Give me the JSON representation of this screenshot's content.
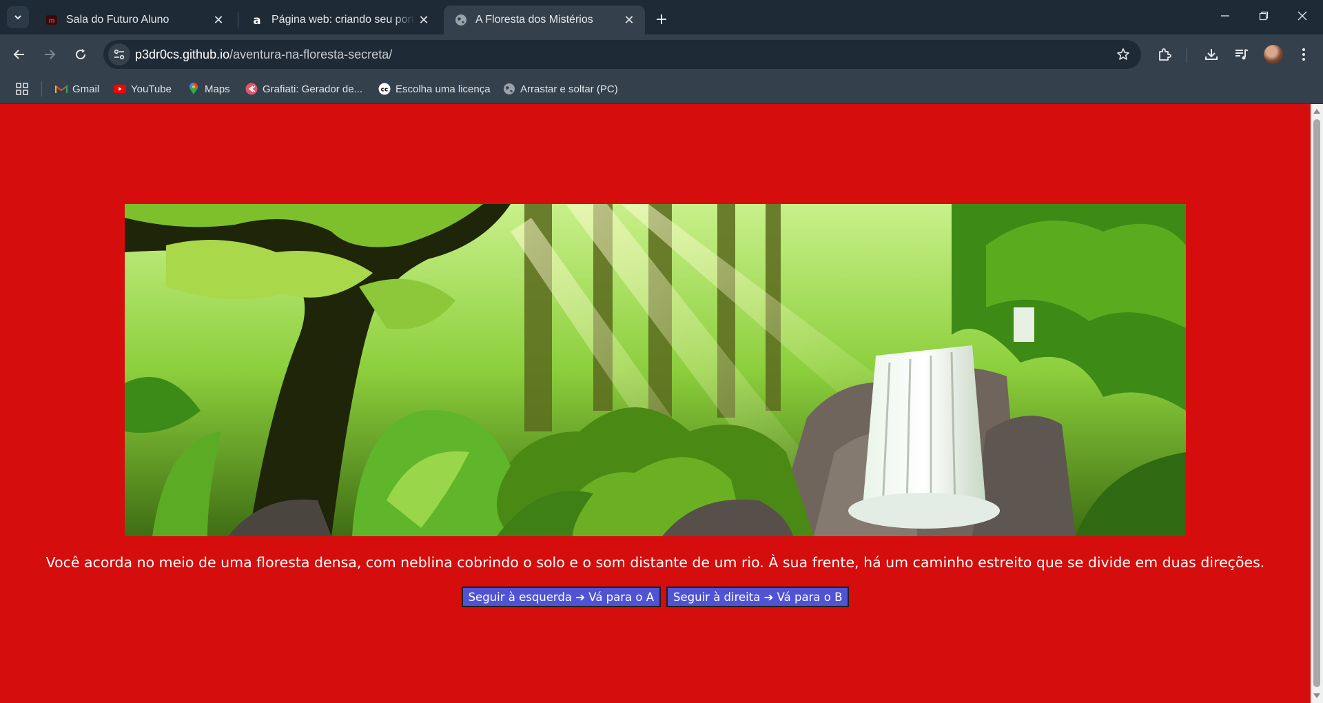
{
  "browser": {
    "tabs": [
      {
        "title": "Sala do Futuro Aluno",
        "icon": "sala-do-futuro-icon",
        "active": false
      },
      {
        "title": "Página web: criando seu portfólio",
        "icon": "alura-icon",
        "active": false
      },
      {
        "title": "A Floresta dos Mistérios",
        "icon": "globe-icon",
        "active": true
      }
    ],
    "address_bar": {
      "host": "p3dr0cs.github.io",
      "path": "/aventura-na-floresta-secreta/"
    },
    "bookmarks": [
      {
        "label": "Gmail",
        "icon": "gmail-icon"
      },
      {
        "label": "YouTube",
        "icon": "youtube-icon"
      },
      {
        "label": "Maps",
        "icon": "maps-icon"
      },
      {
        "label": "Grafiati: Gerador de...",
        "icon": "grafiati-icon"
      },
      {
        "label": "Escolha uma licença",
        "icon": "creative-commons-icon"
      },
      {
        "label": "Arrastar e soltar (PC)",
        "icon": "globe-icon"
      }
    ]
  },
  "page": {
    "background_color": "#d50d0d",
    "story_text": "Você acorda no meio de uma floresta densa, com neblina cobrindo o solo e o som distante de um rio. À sua frente, há um caminho estreito que se divide em duas direções.",
    "choices": [
      {
        "label": "Seguir à esquerda ➔ Vá para o A"
      },
      {
        "label": "Seguir à direita ➔ Vá para o B"
      }
    ],
    "button_color": "#4f54d4"
  }
}
